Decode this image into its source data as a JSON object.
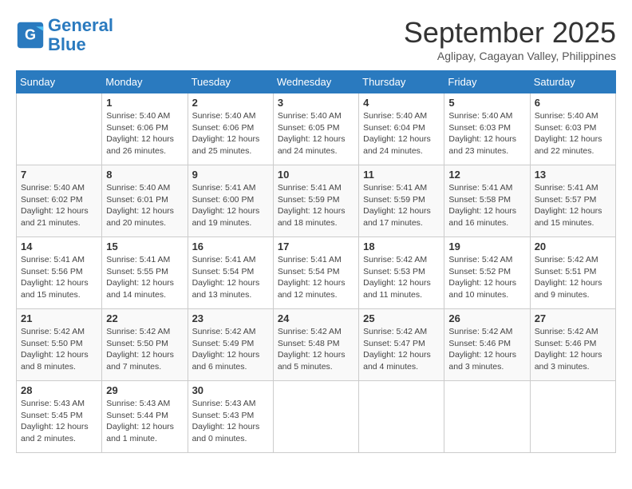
{
  "header": {
    "logo_line1": "General",
    "logo_line2": "Blue",
    "month_title": "September 2025",
    "subtitle": "Aglipay, Cagayan Valley, Philippines"
  },
  "days_of_week": [
    "Sunday",
    "Monday",
    "Tuesday",
    "Wednesday",
    "Thursday",
    "Friday",
    "Saturday"
  ],
  "weeks": [
    [
      {
        "day": "",
        "info": ""
      },
      {
        "day": "1",
        "info": "Sunrise: 5:40 AM\nSunset: 6:06 PM\nDaylight: 12 hours\nand 26 minutes."
      },
      {
        "day": "2",
        "info": "Sunrise: 5:40 AM\nSunset: 6:06 PM\nDaylight: 12 hours\nand 25 minutes."
      },
      {
        "day": "3",
        "info": "Sunrise: 5:40 AM\nSunset: 6:05 PM\nDaylight: 12 hours\nand 24 minutes."
      },
      {
        "day": "4",
        "info": "Sunrise: 5:40 AM\nSunset: 6:04 PM\nDaylight: 12 hours\nand 24 minutes."
      },
      {
        "day": "5",
        "info": "Sunrise: 5:40 AM\nSunset: 6:03 PM\nDaylight: 12 hours\nand 23 minutes."
      },
      {
        "day": "6",
        "info": "Sunrise: 5:40 AM\nSunset: 6:03 PM\nDaylight: 12 hours\nand 22 minutes."
      }
    ],
    [
      {
        "day": "7",
        "info": "Sunrise: 5:40 AM\nSunset: 6:02 PM\nDaylight: 12 hours\nand 21 minutes."
      },
      {
        "day": "8",
        "info": "Sunrise: 5:40 AM\nSunset: 6:01 PM\nDaylight: 12 hours\nand 20 minutes."
      },
      {
        "day": "9",
        "info": "Sunrise: 5:41 AM\nSunset: 6:00 PM\nDaylight: 12 hours\nand 19 minutes."
      },
      {
        "day": "10",
        "info": "Sunrise: 5:41 AM\nSunset: 5:59 PM\nDaylight: 12 hours\nand 18 minutes."
      },
      {
        "day": "11",
        "info": "Sunrise: 5:41 AM\nSunset: 5:59 PM\nDaylight: 12 hours\nand 17 minutes."
      },
      {
        "day": "12",
        "info": "Sunrise: 5:41 AM\nSunset: 5:58 PM\nDaylight: 12 hours\nand 16 minutes."
      },
      {
        "day": "13",
        "info": "Sunrise: 5:41 AM\nSunset: 5:57 PM\nDaylight: 12 hours\nand 15 minutes."
      }
    ],
    [
      {
        "day": "14",
        "info": "Sunrise: 5:41 AM\nSunset: 5:56 PM\nDaylight: 12 hours\nand 15 minutes."
      },
      {
        "day": "15",
        "info": "Sunrise: 5:41 AM\nSunset: 5:55 PM\nDaylight: 12 hours\nand 14 minutes."
      },
      {
        "day": "16",
        "info": "Sunrise: 5:41 AM\nSunset: 5:54 PM\nDaylight: 12 hours\nand 13 minutes."
      },
      {
        "day": "17",
        "info": "Sunrise: 5:41 AM\nSunset: 5:54 PM\nDaylight: 12 hours\nand 12 minutes."
      },
      {
        "day": "18",
        "info": "Sunrise: 5:42 AM\nSunset: 5:53 PM\nDaylight: 12 hours\nand 11 minutes."
      },
      {
        "day": "19",
        "info": "Sunrise: 5:42 AM\nSunset: 5:52 PM\nDaylight: 12 hours\nand 10 minutes."
      },
      {
        "day": "20",
        "info": "Sunrise: 5:42 AM\nSunset: 5:51 PM\nDaylight: 12 hours\nand 9 minutes."
      }
    ],
    [
      {
        "day": "21",
        "info": "Sunrise: 5:42 AM\nSunset: 5:50 PM\nDaylight: 12 hours\nand 8 minutes."
      },
      {
        "day": "22",
        "info": "Sunrise: 5:42 AM\nSunset: 5:50 PM\nDaylight: 12 hours\nand 7 minutes."
      },
      {
        "day": "23",
        "info": "Sunrise: 5:42 AM\nSunset: 5:49 PM\nDaylight: 12 hours\nand 6 minutes."
      },
      {
        "day": "24",
        "info": "Sunrise: 5:42 AM\nSunset: 5:48 PM\nDaylight: 12 hours\nand 5 minutes."
      },
      {
        "day": "25",
        "info": "Sunrise: 5:42 AM\nSunset: 5:47 PM\nDaylight: 12 hours\nand 4 minutes."
      },
      {
        "day": "26",
        "info": "Sunrise: 5:42 AM\nSunset: 5:46 PM\nDaylight: 12 hours\nand 3 minutes."
      },
      {
        "day": "27",
        "info": "Sunrise: 5:42 AM\nSunset: 5:46 PM\nDaylight: 12 hours\nand 3 minutes."
      }
    ],
    [
      {
        "day": "28",
        "info": "Sunrise: 5:43 AM\nSunset: 5:45 PM\nDaylight: 12 hours\nand 2 minutes."
      },
      {
        "day": "29",
        "info": "Sunrise: 5:43 AM\nSunset: 5:44 PM\nDaylight: 12 hours\nand 1 minute."
      },
      {
        "day": "30",
        "info": "Sunrise: 5:43 AM\nSunset: 5:43 PM\nDaylight: 12 hours\nand 0 minutes."
      },
      {
        "day": "",
        "info": ""
      },
      {
        "day": "",
        "info": ""
      },
      {
        "day": "",
        "info": ""
      },
      {
        "day": "",
        "info": ""
      }
    ]
  ]
}
